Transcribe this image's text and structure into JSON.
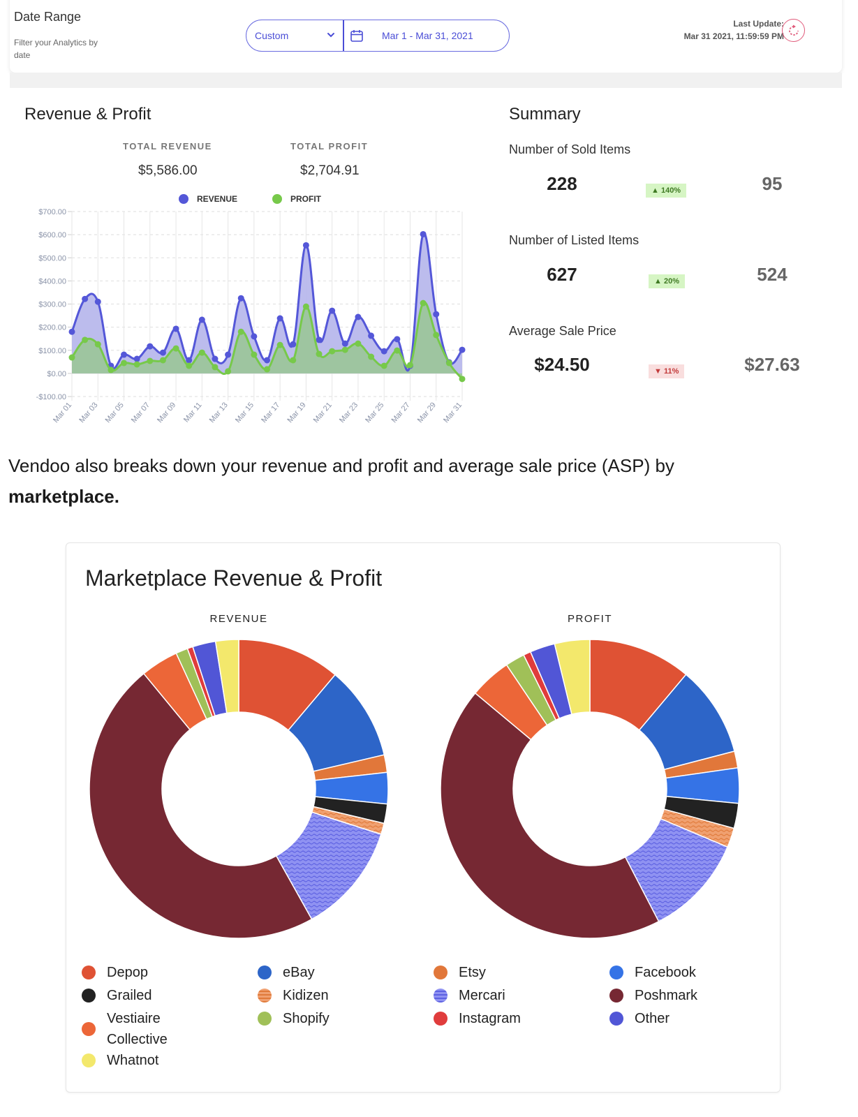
{
  "date_range": {
    "title": "Date Range",
    "subtitle": "Filter your Analytics by date",
    "preset": "Custom",
    "range": "Mar 1 - Mar 31, 2021",
    "last_update_label": "Last Update:",
    "last_update_value": "Mar 31 2021, 11:59:59 PM",
    "accent": "#4a4dd6",
    "refresh_color": "#e05a7a"
  },
  "revenue_profit": {
    "title": "Revenue & Profit",
    "total_revenue_label": "TOTAL REVENUE",
    "total_revenue": "$5,586.00",
    "total_profit_label": "TOTAL PROFIT",
    "total_profit": "$2,704.91",
    "legend": [
      {
        "label": "REVENUE",
        "color": "#5457d8"
      },
      {
        "label": "PROFIT",
        "color": "#77c94a"
      }
    ]
  },
  "summary": {
    "title": "Summary",
    "metrics": [
      {
        "label": "Number of Sold Items",
        "current": "228",
        "change": "140%",
        "direction": "up",
        "previous": "95"
      },
      {
        "label": "Number of Listed Items",
        "current": "627",
        "change": "20%",
        "direction": "up",
        "previous": "524"
      },
      {
        "label": "Average Sale Price",
        "current": "$24.50",
        "change": "11%",
        "direction": "down",
        "previous": "$27.63"
      }
    ]
  },
  "paragraph": {
    "text": "Vendoo also breaks down your revenue and profit and average sale price (ASP) by ",
    "bold": "marketplace."
  },
  "marketplace": {
    "title": "Marketplace Revenue & Profit",
    "revenue_label": "REVENUE",
    "profit_label": "PROFIT",
    "legend": [
      {
        "label": "Depop",
        "color": "#df5234"
      },
      {
        "label": "eBay",
        "color": "#2d65c8"
      },
      {
        "label": "Etsy",
        "color": "#e1773a"
      },
      {
        "label": "Facebook",
        "color": "#3573e6"
      },
      {
        "label": "Grailed",
        "color": "#222222"
      },
      {
        "label": "Kidizen",
        "color": "#e98a4f",
        "pattern": "wave"
      },
      {
        "label": "Mercari",
        "color": "#7f82ee",
        "pattern": "wave"
      },
      {
        "label": "Poshmark",
        "color": "#762833"
      },
      {
        "label": "Vestiaire Collective",
        "color": "#ec6638"
      },
      {
        "label": "Shopify",
        "color": "#a0c058"
      },
      {
        "label": "Instagram",
        "color": "#e03c3c"
      },
      {
        "label": "Other",
        "color": "#5156d6"
      },
      {
        "label": "Whatnot",
        "color": "#f3e86c"
      }
    ]
  },
  "chart_data": [
    {
      "type": "area",
      "title": "Revenue & Profit",
      "xlabel": "",
      "ylabel": "",
      "ylim": [
        -100,
        700
      ],
      "yticks": [
        "$700.00",
        "$600.00",
        "$500.00",
        "$400.00",
        "$300.00",
        "$200.00",
        "$100.00",
        "$0.00",
        "-$100.00"
      ],
      "ytick_values": [
        700,
        600,
        500,
        400,
        300,
        200,
        100,
        0,
        -100
      ],
      "grid": true,
      "legend": "top-center",
      "x": [
        "Mar 01",
        "Mar 02",
        "Mar 03",
        "Mar 04",
        "Mar 05",
        "Mar 06",
        "Mar 07",
        "Mar 08",
        "Mar 09",
        "Mar 10",
        "Mar 11",
        "Mar 12",
        "Mar 13",
        "Mar 14",
        "Mar 15",
        "Mar 16",
        "Mar 17",
        "Mar 18",
        "Mar 19",
        "Mar 20",
        "Mar 21",
        "Mar 22",
        "Mar 23",
        "Mar 24",
        "Mar 25",
        "Mar 26",
        "Mar 27",
        "Mar 28",
        "Mar 29",
        "Mar 30",
        "Mar 31"
      ],
      "xtick_labels": [
        "Mar 01",
        "Mar 03",
        "Mar 05",
        "Mar 07",
        "Mar 09",
        "Mar 11",
        "Mar 13",
        "Mar 15",
        "Mar 17",
        "Mar 19",
        "Mar 21",
        "Mar 23",
        "Mar 25",
        "Mar 27",
        "Mar 29",
        "Mar 31"
      ],
      "series": [
        {
          "name": "REVENUE",
          "color": "#5457d8",
          "fill": "#b8b8ec",
          "values": [
            180,
            322,
            310,
            33,
            81,
            63,
            117,
            90,
            193,
            57,
            232,
            63,
            81,
            325,
            160,
            57,
            238,
            126,
            554,
            145,
            271,
            129,
            244,
            163,
            96,
            148,
            33,
            602,
            256,
            48,
            102
          ]
        },
        {
          "name": "PROFIT",
          "color": "#77c94a",
          "fill": "#9cc59c",
          "values": [
            69,
            145,
            126,
            15,
            45,
            39,
            54,
            57,
            108,
            33,
            90,
            27,
            9,
            180,
            81,
            18,
            123,
            57,
            289,
            84,
            96,
            102,
            129,
            72,
            33,
            99,
            36,
            304,
            166,
            45,
            -24
          ]
        }
      ]
    },
    {
      "type": "pie",
      "title": "REVENUE",
      "donut": true,
      "categories": [
        "Depop",
        "eBay",
        "Etsy",
        "Facebook",
        "Grailed",
        "Kidizen",
        "Mercari",
        "Poshmark",
        "Vestiaire Collective",
        "Shopify",
        "Instagram",
        "Other",
        "Whatnot"
      ],
      "values": [
        11.2,
        10.2,
        1.9,
        3.4,
        2.1,
        1.2,
        12.0,
        47.3,
        4.1,
        1.3,
        0.6,
        2.5,
        2.5
      ],
      "unit": "percent"
    },
    {
      "type": "pie",
      "title": "PROFIT",
      "donut": true,
      "categories": [
        "Depop",
        "eBay",
        "Etsy",
        "Facebook",
        "Grailed",
        "Kidizen",
        "Mercari",
        "Poshmark",
        "Vestiaire Collective",
        "Shopify",
        "Instagram",
        "Other",
        "Whatnot"
      ],
      "values": [
        11.1,
        9.8,
        1.8,
        3.8,
        2.7,
        2.1,
        11.0,
        43.6,
        4.5,
        2.1,
        0.8,
        2.7,
        3.8
      ],
      "unit": "percent"
    }
  ]
}
